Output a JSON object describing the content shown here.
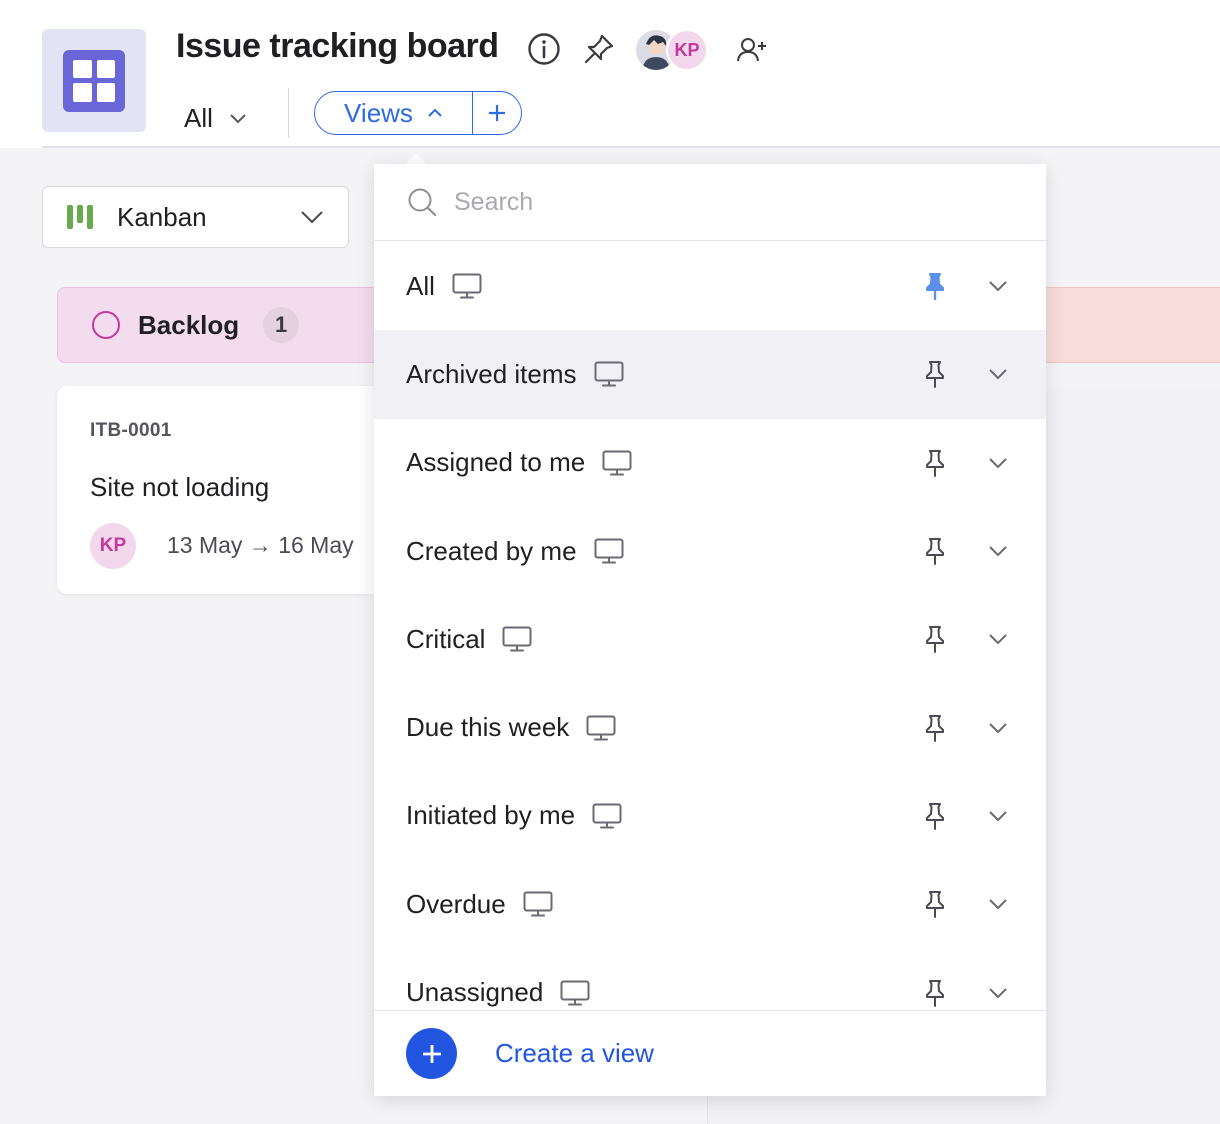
{
  "header": {
    "title": "Issue tracking board",
    "tab_all_label": "All",
    "views_label": "Views",
    "views_add_symbol": "+",
    "member_initials": "KP"
  },
  "board": {
    "layout_select_label": "Kanban",
    "columns": [
      {
        "label": "Backlog",
        "count": "1"
      }
    ],
    "card": {
      "id": "ITB-0001",
      "title": "Site not loading",
      "assignee_initials": "KP",
      "dates": "13 May → 16 May"
    }
  },
  "views_dropdown": {
    "search_placeholder": "Search",
    "items": [
      {
        "label": "All",
        "pinned": true
      },
      {
        "label": "Archived items",
        "pinned": false
      },
      {
        "label": "Assigned to me",
        "pinned": false
      },
      {
        "label": "Created by me",
        "pinned": false
      },
      {
        "label": "Critical",
        "pinned": false
      },
      {
        "label": "Due this week",
        "pinned": false
      },
      {
        "label": "Initiated by me",
        "pinned": false
      },
      {
        "label": "Overdue",
        "pinned": false
      },
      {
        "label": "Unassigned",
        "pinned": false
      }
    ],
    "create_label": "Create a view"
  },
  "colors": {
    "accent_blue": "#2d6be6",
    "create_blue": "#2255e0",
    "pinned_blue": "#5b8fe8",
    "backlog_pink": "#c5399a",
    "app_purple": "#6b66d8"
  }
}
